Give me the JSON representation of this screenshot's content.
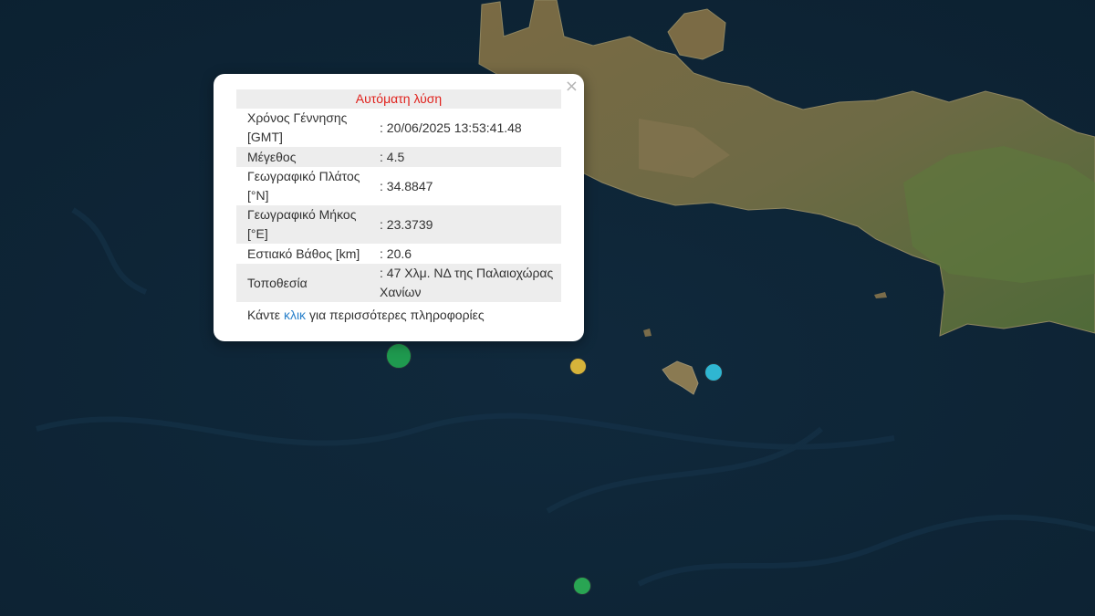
{
  "popup": {
    "close_symbol": "×",
    "heading": "Αυτόματη λύση",
    "rows": [
      {
        "label": "Χρόνος Γέννησης [GMT]",
        "value": ": 20/06/2025 13:53:41.48"
      },
      {
        "label": "Μέγεθος",
        "value": ": 4.5"
      },
      {
        "label": "Γεωγραφικό Πλάτος [°N]",
        "value": ": 34.8847"
      },
      {
        "label": "Γεωγραφικό Μήκος [°E]",
        "value": ": 23.3739"
      },
      {
        "label": "Εστιακό Βάθος [km]",
        "value": ": 20.6"
      },
      {
        "label": "Τοποθεσία",
        "value": ": 47 Χλμ. ΝΔ της Παλαιοχώρας Χανίων"
      }
    ],
    "more_prefix": "Κάντε",
    "more_link": "κλικ",
    "more_suffix": "για περισσότερες πληροφορίες"
  },
  "markers": [
    {
      "name": "selected-earthquake-marker",
      "color": "#1f9a4f"
    },
    {
      "name": "earthquake-marker-yellow",
      "color": "#d6b33a"
    },
    {
      "name": "earthquake-marker-cyan",
      "color": "#2fb6d2"
    },
    {
      "name": "earthquake-marker-green-south",
      "color": "#29a553"
    }
  ],
  "colors": {
    "sea": "#0f2638",
    "land": "#6f6a43",
    "accent": "#e0211c",
    "link": "#2a81cb"
  }
}
